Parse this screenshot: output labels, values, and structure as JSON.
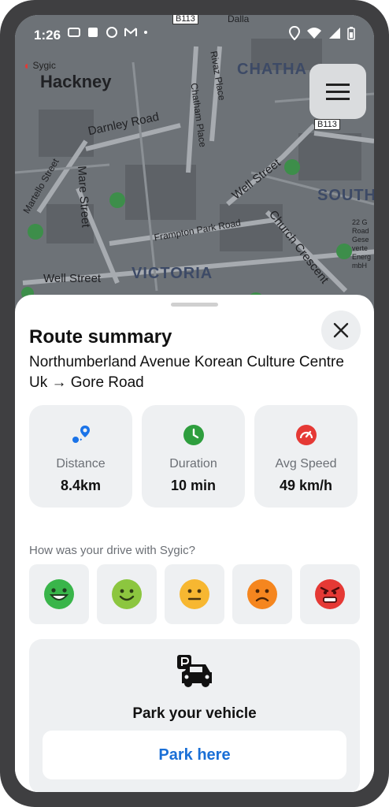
{
  "status_bar": {
    "time": "1:26"
  },
  "map": {
    "logo_text": "Sygic",
    "place_labels": {
      "hackney": "Hackney",
      "chatham": "CHATHA",
      "south": "SOUTH",
      "victoria": "VICTORIA"
    },
    "street_labels": {
      "darnley_road": "Darnley Road",
      "mare_street": "Mare Street",
      "well_street_1": "Well Street",
      "well_street_2": "Well Street",
      "frampton_park": "Frampton Park Road",
      "church_crescent": "Church Crescent",
      "chatham_place": "Chatham Place",
      "rivaz_place": "Rivaz Place",
      "martello_street": "Martello Street",
      "b113_top": "B113",
      "b113_right": "B113",
      "dalla": "Dalla",
      "side_note": "22 G Road Gese verte Energ mbH"
    }
  },
  "summary": {
    "title": "Route summary",
    "route": "Northumberland Avenue Korean Culture Centre Uk → Gore Road",
    "stats": [
      {
        "label": "Distance",
        "value": "8.4km",
        "icon": "route-pin-icon",
        "color": "#1a73e8"
      },
      {
        "label": "Duration",
        "value": "10 min",
        "icon": "clock-icon",
        "color": "#2e9e3e"
      },
      {
        "label": "Avg Speed",
        "value": "49 km/h",
        "icon": "speedometer-icon",
        "color": "#e53935"
      }
    ],
    "question": "How was your drive with Sygic?",
    "ratings": [
      {
        "name": "very-happy-face-icon",
        "color": "#39b54a"
      },
      {
        "name": "happy-face-icon",
        "color": "#8cc63f"
      },
      {
        "name": "neutral-face-icon",
        "color": "#f7b731"
      },
      {
        "name": "sad-face-icon",
        "color": "#f5861f"
      },
      {
        "name": "angry-face-icon",
        "color": "#e53935"
      }
    ],
    "park": {
      "title": "Park your vehicle",
      "button": "Park here"
    }
  }
}
